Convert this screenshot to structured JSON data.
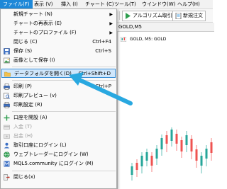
{
  "menubar": {
    "items": [
      {
        "label": "ファイル(F)"
      },
      {
        "label": "表示 (V)"
      },
      {
        "label": "挿入 (I)"
      },
      {
        "label": "チャート (C)"
      },
      {
        "label": "ツール(T)"
      },
      {
        "label": "ウインドウ(W)"
      },
      {
        "label": "ヘルプ(H)"
      }
    ]
  },
  "toolbar": {
    "algo_label": "アルゴリズム取引",
    "new_order_label": "新規注文"
  },
  "chart": {
    "tab_label": "GOLD,M5",
    "header": "GOLD, M5:  GOLD",
    "candle_colors": {
      "up": "#26a69a",
      "down": "#ef5350"
    }
  },
  "file_menu": {
    "items": [
      {
        "label": "新規チャート (N)",
        "shortcut": "",
        "submenu": true,
        "icon": "none"
      },
      {
        "label": "チャートの再表示 (E)",
        "shortcut": "",
        "submenu": true,
        "icon": "none"
      },
      {
        "label": "チャートのプロファイル (F)",
        "shortcut": "",
        "submenu": true,
        "icon": "none"
      },
      {
        "label": "閉じる (C)",
        "shortcut": "Ctrl+F4",
        "icon": "none"
      },
      {
        "label": "保存 (S)",
        "shortcut": "Ctrl+S",
        "icon": "save-icon"
      },
      {
        "label": "画像として保存 (I)",
        "shortcut": "",
        "icon": "image-icon"
      },
      {
        "label": "データフォルダを開く(D)",
        "shortcut": "Ctrl+Shift+D",
        "icon": "folder-icon",
        "highlighted": true
      },
      {
        "label": "印刷 (P)",
        "shortcut": "Ctrl+P",
        "icon": "print-icon"
      },
      {
        "label": "印刷プレビュー (v)",
        "shortcut": "",
        "icon": "print-preview-icon"
      },
      {
        "label": "印刷設定 (R)",
        "shortcut": "",
        "icon": "print-setup-icon"
      },
      {
        "label": "口座を開設 (A)",
        "shortcut": "",
        "icon": "plus-icon"
      },
      {
        "label": "入金 (T)",
        "shortcut": "",
        "icon": "deposit-icon",
        "disabled": true
      },
      {
        "label": "出金 (H)",
        "shortcut": "",
        "icon": "withdraw-icon",
        "disabled": true
      },
      {
        "label": "取引口座にログイン (L)",
        "shortcut": "",
        "icon": "login-icon"
      },
      {
        "label": "ウェブトレーダーにログイン (W)",
        "shortcut": "",
        "icon": "webtrader-icon"
      },
      {
        "label": "MQL5.community にログイン (M)",
        "shortcut": "",
        "icon": "mql5-icon"
      },
      {
        "label": "閉じる(x)",
        "shortcut": "",
        "icon": "exit-icon"
      }
    ]
  },
  "colors": {
    "highlight_bg": "#cfe6fb",
    "highlight_border": "#3a8fd6",
    "menu_active": "#1e88d8",
    "arrow": "#29a8e0"
  }
}
